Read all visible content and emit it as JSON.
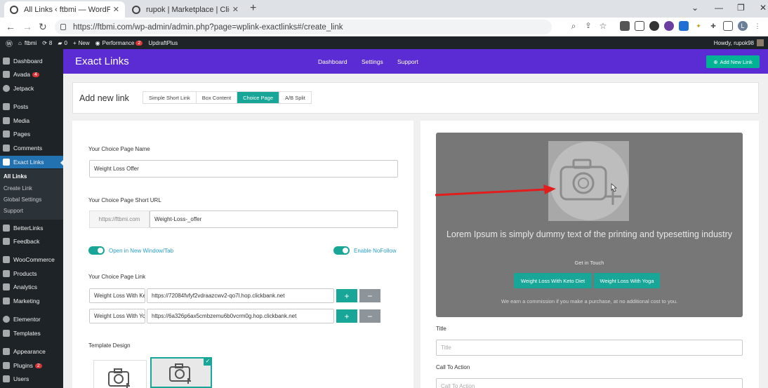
{
  "browser": {
    "tabs": [
      {
        "title": "All Links ‹ ftbmi — WordPress",
        "active": true
      },
      {
        "title": "rupok | Marketplace | ClickBank /",
        "active": false
      }
    ],
    "url": "https://ftbmi.com/wp-admin/admin.php?page=wplink-exactlinks#/create_link",
    "icons": [
      "zoom-icon",
      "share-icon",
      "star-icon",
      "extension-icon",
      "profile-icon"
    ]
  },
  "admin_bar": {
    "site": "ftbmi",
    "updates": "8",
    "comments": "0",
    "new": "New",
    "performance": "Performance",
    "performance_badge": "2",
    "updraft": "UpdraftPlus",
    "howdy": "Howdy, rupok98"
  },
  "sidebar": {
    "items": [
      {
        "label": "Dashboard"
      },
      {
        "label": "Avada",
        "badge": "4"
      },
      {
        "label": "Jetpack"
      },
      {
        "label": "Posts"
      },
      {
        "label": "Media"
      },
      {
        "label": "Pages"
      },
      {
        "label": "Comments"
      },
      {
        "label": "Exact Links"
      },
      {
        "label": "BetterLinks"
      },
      {
        "label": "Feedback"
      },
      {
        "label": "WooCommerce"
      },
      {
        "label": "Products"
      },
      {
        "label": "Analytics"
      },
      {
        "label": "Marketing"
      },
      {
        "label": "Elementor"
      },
      {
        "label": "Templates"
      },
      {
        "label": "Appearance"
      },
      {
        "label": "Plugins",
        "badge": "2"
      },
      {
        "label": "Users"
      }
    ],
    "submenu": [
      "All Links",
      "Create Link",
      "Global Settings",
      "Support"
    ]
  },
  "plugin": {
    "logo": "Exact Links",
    "nav": [
      "Dashboard",
      "Settings",
      "Support"
    ],
    "add_new": "Add New Link"
  },
  "top_card": {
    "title": "Add new link",
    "tabs": [
      "Simple Short Link",
      "Box Content",
      "Choice Page",
      "A/B Split"
    ],
    "active_tab": "Choice Page"
  },
  "form": {
    "name_label": "Your Choice Page Name",
    "name_value": "Weight Loss Offer",
    "short_url_label": "Your Choice Page Short URL",
    "short_url_prefix": "https://ftbmi.com",
    "short_url_value": "Weight-Loss-_offer",
    "toggle_new_window": "Open in New Window/Tab",
    "toggle_nofollow": "Enable NoFollow",
    "links_label": "Your Choice Page Link",
    "links": [
      {
        "name": "Weight Loss With Keto Diet",
        "url": "https://72084fvfyf2vdraazcwv2-qo7l.hop.clickbank.net"
      },
      {
        "name": "Weight Loss With Yoga",
        "url": "https://6a326p6ax5cmbzemu6b0vcrm0g.hop.clickbank.net"
      }
    ],
    "plus": "+",
    "minus": "−",
    "template_label": "Template Design"
  },
  "preview": {
    "headline": "Lorem Ipsum is simply dummy text of the printing and typesetting industry",
    "sub": "Get in Touch",
    "buttons": [
      "Weight Loss With Keto Diet",
      "Weight Loss With Yoga"
    ],
    "note": "We earn a commission if you make a purchase, at no additional cost to you.",
    "title_label": "Title",
    "title_placeholder": "Title",
    "cta_label": "Call To Action",
    "cta_placeholder": "Call To Action"
  },
  "colors": {
    "plugin_header": "#5b2bd4",
    "accent": "#17a697",
    "wp_dark": "#1d2327",
    "wp_blue": "#2271b1",
    "annotation_red": "#e11d1d"
  }
}
